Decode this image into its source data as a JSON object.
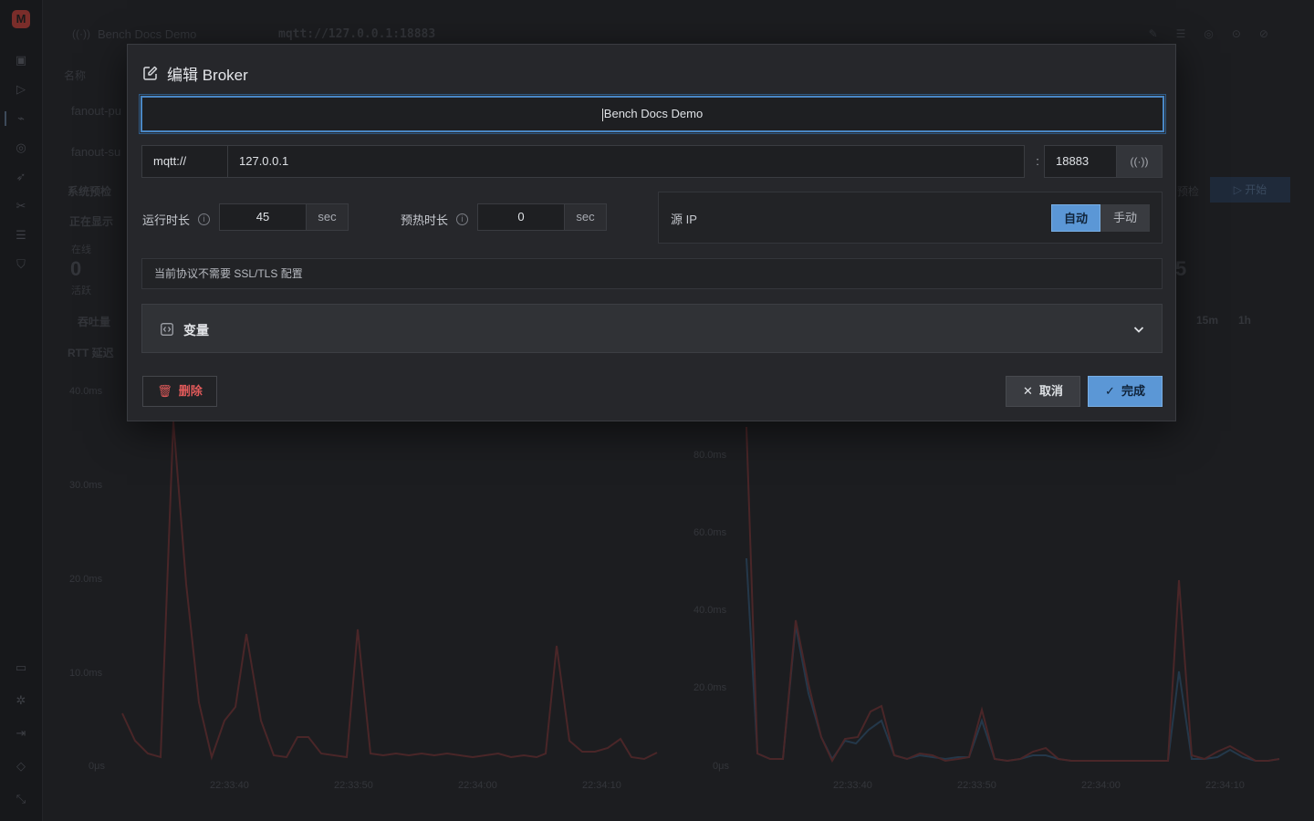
{
  "background": {
    "topbar": {
      "title": "Bench Docs Demo",
      "url": "mqtt://127.0.0.1:18883"
    },
    "labels": {
      "name_col": "名称",
      "row1": "fanout-pu",
      "row2": "fanout-su",
      "sys_check": "系统预检",
      "showing": "正在显示",
      "online": "在线",
      "online_value": "0",
      "active": "活跃",
      "throughput": "吞吐量",
      "rtt": "RTT 延迟",
      "precheck": "预检",
      "start": "开始",
      "big_right": "5",
      "range_15m": "15m",
      "range_1h": "1h"
    },
    "chart_left": {
      "y_ticks": [
        "40.0ms",
        "30.0ms",
        "20.0ms",
        "10.0ms",
        "0μs"
      ],
      "x_ticks": [
        "22:33:40",
        "22:33:50",
        "22:34:00",
        "22:34:10"
      ]
    },
    "chart_right": {
      "y_ticks": [
        "80.0ms",
        "60.0ms",
        "40.0ms",
        "20.0ms",
        "0μs"
      ],
      "x_ticks": [
        "22:33:40",
        "22:33:50",
        "22:34:00",
        "22:34:10"
      ]
    }
  },
  "modal": {
    "title": "编辑 Broker",
    "name_value": "Bench Docs Demo",
    "protocol": "mqtt://",
    "host": "127.0.0.1",
    "colon": ":",
    "port": "18883",
    "run_duration": {
      "label": "运行时长",
      "value": "45",
      "unit": "sec"
    },
    "warmup_duration": {
      "label": "预热时长",
      "value": "0",
      "unit": "sec"
    },
    "source_ip": {
      "label": "源 IP",
      "auto": "自动",
      "manual": "手动",
      "selected": "自动"
    },
    "ssl_note": "当前协议不需要 SSL/TLS 配置",
    "variables": "变量",
    "delete": "删除",
    "cancel": "取消",
    "done": "完成"
  },
  "colors": {
    "accent": "#5b97d6",
    "danger": "#e05a5a",
    "modal_bg": "#26272b"
  }
}
